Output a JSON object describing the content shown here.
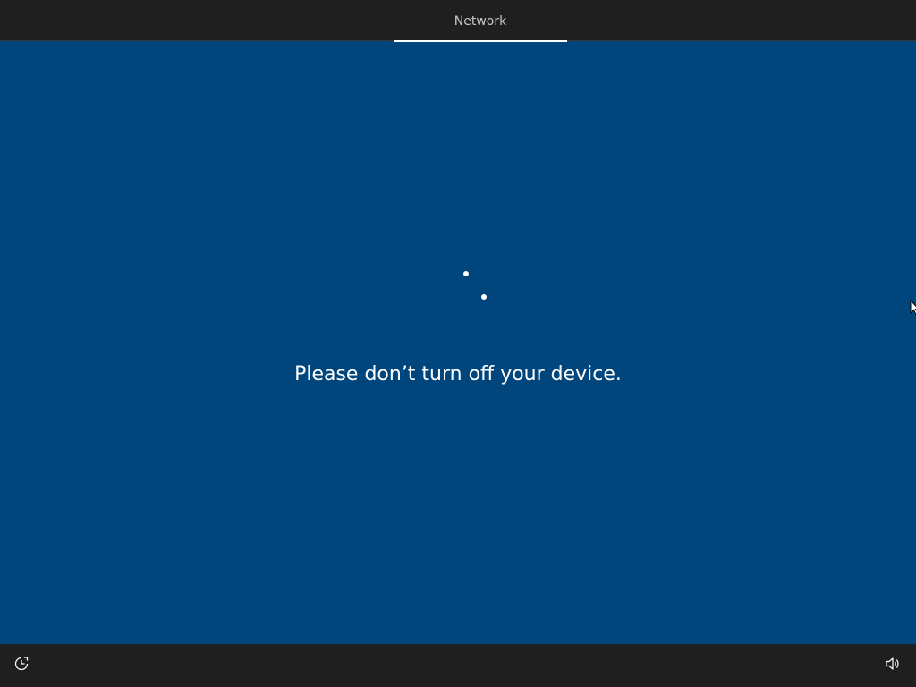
{
  "header": {
    "tabs": [
      {
        "label": "Network",
        "active": true
      }
    ]
  },
  "main": {
    "status_text": "Please don’t turn off your device."
  },
  "footer": {
    "left_icon": "ease-of-access-icon",
    "right_icon": "volume-icon"
  },
  "colors": {
    "background": "#00457c",
    "bar": "#1f1f1f",
    "text": "#ffffff",
    "tab_text": "#c8c8c8"
  }
}
